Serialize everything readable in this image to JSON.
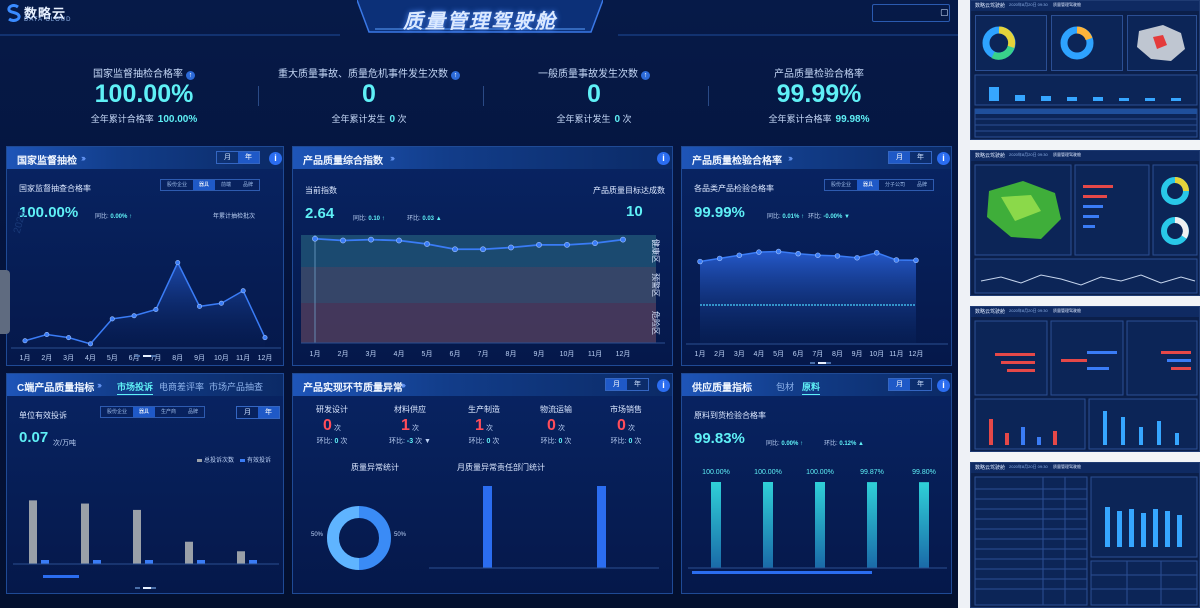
{
  "header": {
    "logo_text": "数略云",
    "logo_sub": "DATA CLOUD",
    "title": "质量管理驾驶舱",
    "collapse_icon": "square-icon"
  },
  "kpis": [
    {
      "label": "国家监督抽检合格率",
      "value": "100.00%",
      "sub_label": "全年累计合格率",
      "sub_value": "100.00%",
      "sub_unit": "",
      "icon": "info-icon"
    },
    {
      "label": "重大质量事故、质量危机事件发生次数",
      "value": "0",
      "sub_label": "全年累计发生",
      "sub_value": "0",
      "sub_unit": "次",
      "icon": "info-icon"
    },
    {
      "label": "一般质量事故发生次数",
      "value": "0",
      "sub_label": "全年累计发生",
      "sub_value": "0",
      "sub_unit": "次",
      "icon": "info-icon"
    },
    {
      "label": "产品质量检验合格率",
      "value": "99.99%",
      "sub_label": "全年累计合格率",
      "sub_value": "99.98%",
      "sub_unit": "",
      "icon": ""
    }
  ],
  "months": [
    "1月",
    "2月",
    "3月",
    "4月",
    "5月",
    "6月",
    "7月",
    "8月",
    "9月",
    "10月",
    "11月",
    "12月"
  ],
  "panel_national": {
    "title": "国家监督抽检",
    "toggle": [
      "月",
      "年"
    ],
    "active_toggle": 1,
    "metric_label": "国家监督抽查合格率",
    "segments": [
      "股份企业",
      "器具",
      "前端",
      "品牌"
    ],
    "active_segment": 1,
    "value": "100.00%",
    "compare_label": "同比:",
    "compare_value": "0.00%",
    "compare_arrow": "↑",
    "right_label": "年累计抽检批次",
    "watermark": "2023"
  },
  "panel_index": {
    "title": "产品质量综合指数",
    "metric_label": "当前指数",
    "value": "2.64",
    "yoy_label": "同比:",
    "yoy_value": "0.10",
    "yoy_arrow": "↑",
    "mom_label": "环比:",
    "mom_value": "0.03",
    "mom_arrow": "▲",
    "target_label": "产品质量目标达成数",
    "target_value": "10",
    "zones": [
      "健康区",
      "预警区",
      "危险区"
    ]
  },
  "panel_inspect": {
    "title": "产品质量检验合格率",
    "toggle": [
      "月",
      "年"
    ],
    "active_toggle": 0,
    "metric_label": "各品类产品检验合格率",
    "segments": [
      "股份企业",
      "器具",
      "分子公司",
      "品牌"
    ],
    "active_segment": 1,
    "value": "99.99%",
    "yoy_label": "同比:",
    "yoy_value": "0.01%",
    "yoy_arrow": "↑",
    "mom_label": "环比:",
    "mom_value": "-0.00%",
    "mom_arrow": "▼"
  },
  "panel_c": {
    "title": "C端产品质量指标",
    "tabs": [
      "市场投诉",
      "电商差评率",
      "市场产品抽查"
    ],
    "active_tab": 0,
    "metric_label": "单位有效投诉",
    "segments": [
      "股份企业",
      "器具",
      "生产商",
      "品牌"
    ],
    "active_segment": 1,
    "toggle": [
      "月",
      "年"
    ],
    "active_toggle": 1,
    "value": "0.07",
    "unit": "次/万吨",
    "legend": [
      "总投诉次数",
      "有效投诉"
    ]
  },
  "panel_abn": {
    "title": "产品实现环节质量异常",
    "toggle": [
      "月",
      "年"
    ],
    "active_toggle": 0,
    "depts": [
      {
        "name": "研发设计",
        "value": "0",
        "unit": "次",
        "cmp_label": "环比:",
        "cmp_value": "0",
        "cmp_unit": "次",
        "arrow": ""
      },
      {
        "name": "材料供应",
        "value": "1",
        "unit": "次",
        "cmp_label": "环比:",
        "cmp_value": "-3",
        "cmp_unit": "次",
        "arrow": "▼"
      },
      {
        "name": "生产制造",
        "value": "1",
        "unit": "次",
        "cmp_label": "环比:",
        "cmp_value": "0",
        "cmp_unit": "次",
        "arrow": ""
      },
      {
        "name": "物流运输",
        "value": "0",
        "unit": "次",
        "cmp_label": "环比:",
        "cmp_value": "0",
        "cmp_unit": "次",
        "arrow": ""
      },
      {
        "name": "市场销售",
        "value": "0",
        "unit": "次",
        "cmp_label": "环比:",
        "cmp_value": "0",
        "cmp_unit": "次",
        "arrow": ""
      }
    ],
    "donut_title": "质量异常统计",
    "donut_left": "50%",
    "donut_right": "50%",
    "bars_title": "月质量异常责任部门统计"
  },
  "panel_supply": {
    "title": "供应质量指标",
    "tabs": [
      "包材",
      "原料"
    ],
    "active_tab": 1,
    "toggle": [
      "月",
      "年"
    ],
    "active_toggle": 0,
    "metric_label": "原料到货检验合格率",
    "value": "99.83%",
    "yoy_label": "同比:",
    "yoy_value": "0.00%",
    "yoy_arrow": "↑",
    "mom_label": "环比:",
    "mom_value": "0.12%",
    "mom_arrow": "▲"
  },
  "thumbnails": {
    "brand": "数略云驾驶舱",
    "date": "2020年8月20日 09:30",
    "caption": "质量管理驾驶舱"
  },
  "chart_data": [
    {
      "type": "line",
      "name_ref": "国家监督抽查合格率",
      "categories": [
        "1月",
        "2月",
        "3月",
        "4月",
        "5月",
        "6月",
        "7月",
        "8月",
        "9月",
        "10月",
        "11月",
        "12月"
      ],
      "values": [
        2,
        4,
        3,
        1,
        9,
        10,
        12,
        27,
        13,
        14,
        18,
        3
      ],
      "ylim": [
        0,
        32
      ]
    },
    {
      "type": "line",
      "name_ref": "当前指数",
      "categories": [
        "1月",
        "2月",
        "3月",
        "4月",
        "5月",
        "6月",
        "7月",
        "8月",
        "9月",
        "10月",
        "11月",
        "12月"
      ],
      "values": [
        2.7,
        2.68,
        2.69,
        2.68,
        2.64,
        2.58,
        2.58,
        2.6,
        2.63,
        2.63,
        2.65,
        2.69
      ],
      "ylim": [
        0,
        3
      ]
    },
    {
      "type": "area",
      "name_ref": "各品类产品检验合格率",
      "categories": [
        "1月",
        "2月",
        "3月",
        "4月",
        "5月",
        "6月",
        "7月",
        "8月",
        "9月",
        "10月",
        "11月",
        "12月"
      ],
      "values": [
        99.6,
        99.7,
        99.8,
        99.9,
        99.92,
        99.85,
        99.8,
        99.78,
        99.72,
        99.88,
        99.65,
        99.64
      ],
      "ylim": [
        97.0,
        100.0
      ]
    },
    {
      "type": "bar",
      "name_ref": "单位有效投诉",
      "series": [
        {
          "name": "总投诉次数",
          "values": [
            20,
            19,
            17,
            7,
            4
          ]
        },
        {
          "name": "有效投诉",
          "values": [
            1,
            1,
            1,
            1,
            1
          ]
        }
      ],
      "ylim": [
        0,
        22
      ]
    },
    {
      "type": "pie",
      "name_ref": "质量异常统计",
      "values": [
        50,
        50
      ]
    },
    {
      "type": "bar",
      "name_ref": "月质量异常责任部门统计",
      "values": [
        1,
        1
      ],
      "ylim": [
        0,
        1
      ]
    },
    {
      "type": "bar",
      "name_ref": "原料到货检验合格率",
      "categories": [
        "1",
        "2",
        "3",
        "4",
        "5"
      ],
      "values": [
        100.0,
        100.0,
        100.0,
        99.87,
        99.8
      ],
      "labels": [
        "100.00%",
        "100.00%",
        "100.00%",
        "99.87%",
        "99.80%"
      ],
      "ylim": [
        0,
        100
      ]
    }
  ]
}
